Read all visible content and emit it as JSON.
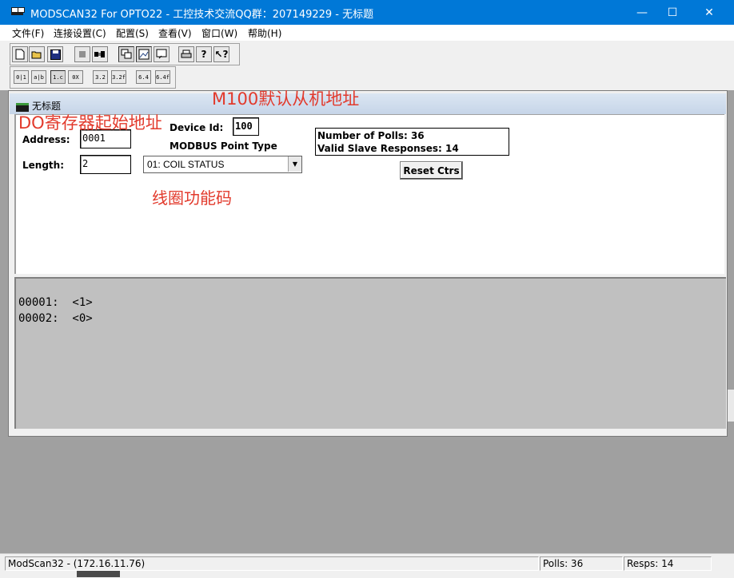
{
  "window": {
    "title": "MODSCAN32 For OPTO22 - 工控技术交流QQ群：207149229 - 无标题",
    "minimize": "—",
    "maximize": "☐",
    "close": "✕"
  },
  "menu": {
    "file": "文件(F)",
    "connection": "连接设置(C)",
    "setup": "配置(S)",
    "view": "查看(V)",
    "window": "窗口(W)",
    "help": "帮助(H)"
  },
  "toolbar2": {
    "b1": "0|1",
    "b2": "a|b",
    "b3": "1.c",
    "b4": "0X",
    "b5": "3.2",
    "b6": "3.2f",
    "b7": "6.4",
    "b8": "6.4f"
  },
  "child_window": {
    "title": "无标题"
  },
  "annotations": {
    "slave_address": "M100默认从机地址",
    "start_address": "DO寄存器起始地址",
    "function_code": "线圈功能码"
  },
  "form": {
    "address_label": "Address:",
    "address_value": "0001",
    "length_label": "Length:",
    "length_value": "2",
    "device_id_label": "Device Id:",
    "device_id_value": "100",
    "point_type_label": "MODBUS Point Type",
    "point_type_value": "01: COIL STATUS",
    "polls_text": "Number of Polls: 36",
    "responses_text": "Valid Slave Responses: 14",
    "reset_button": "Reset Ctrs"
  },
  "data_rows": [
    "00001:  <1>",
    "00002:  <0>"
  ],
  "statusbar": {
    "main": "ModScan32 - (172.16.11.76)",
    "polls": "Polls: 36",
    "resps": "Resps: 14"
  }
}
